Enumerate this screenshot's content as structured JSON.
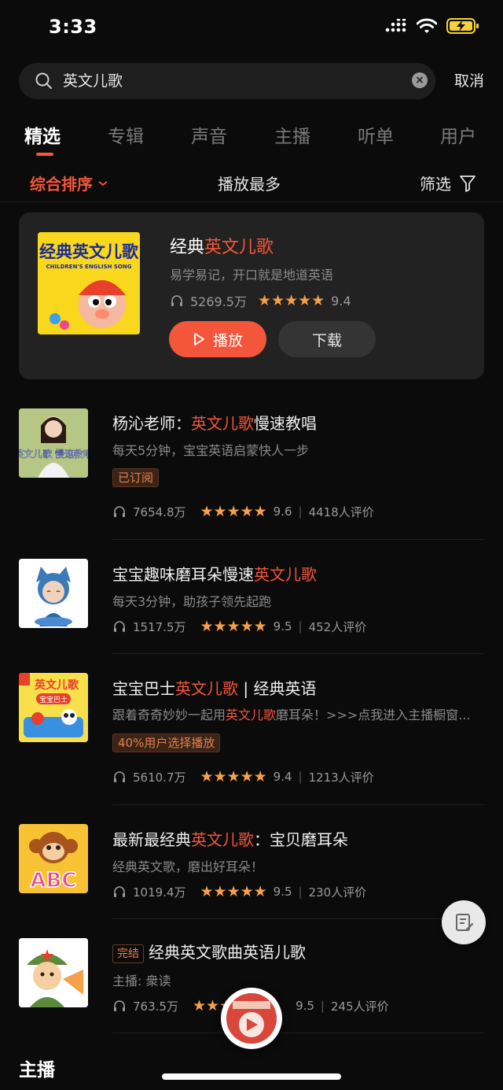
{
  "status": {
    "time": "3:33"
  },
  "search": {
    "query": "英文儿歌",
    "cancel_label": "取消"
  },
  "tabs": [
    {
      "label": "精选",
      "active": true
    },
    {
      "label": "专辑",
      "active": false
    },
    {
      "label": "声音",
      "active": false
    },
    {
      "label": "主播",
      "active": false
    },
    {
      "label": "听单",
      "active": false
    },
    {
      "label": "用户",
      "active": false
    }
  ],
  "sort": {
    "main_label": "综合排序",
    "most_played_label": "播放最多",
    "filter_label": "筛选"
  },
  "featured": {
    "title_prefix": "经典",
    "title_highlight": "英文儿歌",
    "subtitle": "易学易记，开口就是地道英语",
    "plays": "5269.5万",
    "stars": "★★★★★",
    "rating": "9.4",
    "play_label": "播放",
    "download_label": "下载",
    "cover_text": "经典英文儿歌",
    "cover_subtext": "CHILDREN'S ENGLISH SONG"
  },
  "results": [
    {
      "title_prefix": "杨沁老师：",
      "title_highlight": "英文儿歌",
      "title_suffix": "慢速教唱",
      "subtitle": "每天5分钟，宝宝英语启蒙快人一步",
      "tag": "已订阅",
      "plays": "7654.8万",
      "stars": "★★★★★",
      "rating": "9.6",
      "reviews": "4418人评价",
      "cover_text": "英文儿歌 慢速教唱"
    },
    {
      "title_prefix": "宝宝趣味磨耳朵慢速",
      "title_highlight": "英文儿歌",
      "title_suffix": "",
      "subtitle": "每天3分钟，助孩子领先起跑",
      "plays": "1517.5万",
      "stars": "★★★★★",
      "rating": "9.5",
      "reviews": "452人评价"
    },
    {
      "title_prefix": "宝宝巴士",
      "title_highlight": "英文儿歌",
      "title_suffix": " | 经典英语",
      "subtitle_prefix": "跟着奇奇妙妙一起用",
      "subtitle_highlight": "英文儿歌",
      "subtitle_suffix": "磨耳朵！>>>点我进入主播橱窗...",
      "tag": "40%用户选择播放",
      "plays": "5610.7万",
      "stars": "★★★★★",
      "rating": "9.4",
      "reviews": "1213人评价",
      "cover_text": "英文儿歌",
      "cover_subtext": "宝宝巴士"
    },
    {
      "title_prefix": "最新最经典",
      "title_highlight": "英文儿歌",
      "title_suffix": "：宝贝磨耳朵",
      "subtitle": "经典英文歌，磨出好耳朵！",
      "plays": "1019.4万",
      "stars": "★★★★★",
      "rating": "9.5",
      "reviews": "230人评价",
      "cover_text": "ABC"
    },
    {
      "badge": "完结",
      "title_prefix": "经典英文歌曲英语儿歌",
      "subtitle": "主播: 衆读",
      "plays": "763.5万",
      "stars": "★★★",
      "rating": "9.5",
      "reviews": "245人评价"
    }
  ],
  "section": {
    "heading": "主播"
  },
  "colors": {
    "accent": "#f4563b",
    "star": "#f7a04a",
    "background": "#0b0b0b"
  }
}
